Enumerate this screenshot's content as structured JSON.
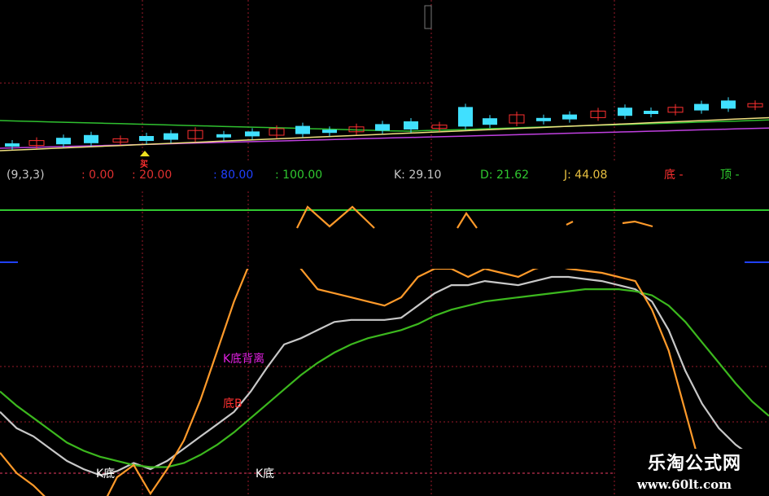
{
  "header": {
    "params": "(9,3,3)",
    "level_0": ": 0.00",
    "level_20": ": 20.00",
    "level_80": ": 80.00",
    "level_100": ": 100.00",
    "k_label": "K: 29.10",
    "d_label": "D: 21.62",
    "j_label": "J: 44.08",
    "bottom_label": "底 -",
    "top_label": "顶 -"
  },
  "colors": {
    "k_line": "#c8c8c8",
    "d_line": "#3cb81e",
    "j_line": "#ff9a2a",
    "grid": "#9a1a2a",
    "header_params": "#c8c8c8",
    "level_0": "#e03030",
    "level_20": "#e03030",
    "level_80": "#2040ff",
    "level_100": "#30c830",
    "k_text": "#c8c8c8",
    "d_text": "#30c830",
    "j_text": "#e8c040",
    "bottom_text": "#ff3030",
    "top_text": "#30d030",
    "magenta_label": "#e020e0",
    "red_label": "#ff3030"
  },
  "annotations": {
    "k_bottom_divergence": "K底背离",
    "bottom_b": "底B",
    "k_bottom_1": "K底",
    "k_bottom_2": "K底"
  },
  "price_panel": {
    "buy_marker": "买"
  },
  "watermark": {
    "title": "乐淘公式网",
    "url": "www.60lt.com"
  },
  "chart_data": [
    {
      "type": "candlestick",
      "title": "",
      "x": [
        0,
        1,
        2,
        3,
        4,
        5,
        6,
        7,
        8,
        9,
        10,
        11,
        12,
        13,
        14,
        15,
        16,
        17,
        18,
        19,
        20,
        21,
        22,
        23,
        24,
        25,
        26,
        27,
        28,
        29,
        30,
        31,
        32,
        33,
        34,
        35,
        36,
        37,
        38,
        39,
        40,
        41,
        42,
        43,
        44,
        45
      ],
      "candles_note": "",
      "series": [
        {
          "name": "",
          "values": [
            176,
            176,
            175,
            174,
            173,
            173,
            172,
            171,
            170,
            170,
            169,
            168,
            168,
            167,
            166,
            166,
            166,
            165,
            165,
            164,
            164,
            164,
            163,
            163,
            163,
            163,
            162,
            162,
            162,
            162,
            161,
            161,
            160,
            160,
            160,
            160,
            159,
            159,
            158,
            158,
            158,
            157,
            157,
            157,
            156,
            156
          ]
        }
      ]
    },
    {
      "type": "line",
      "title": "",
      "x": [
        0,
        1,
        2,
        3,
        4,
        5,
        6,
        7,
        8,
        9,
        10,
        11,
        12,
        13,
        14,
        15,
        16,
        17,
        18,
        19,
        20,
        21,
        22,
        23,
        24,
        25,
        26,
        27,
        28,
        29,
        30,
        31,
        32,
        33,
        34,
        35,
        36,
        37,
        38,
        39,
        40,
        41,
        42,
        43,
        44,
        45,
        46
      ],
      "ylim": [
        -5,
        105
      ],
      "levels": [
        0,
        20,
        80,
        100
      ],
      "series": [
        {
          "name": "K",
          "values": [
            30,
            22,
            18,
            12,
            6,
            2,
            -1,
            1,
            5,
            2,
            6,
            12,
            18,
            24,
            30,
            40,
            52,
            63,
            66,
            70,
            74,
            75,
            75,
            75,
            76,
            82,
            88,
            92,
            92,
            94,
            93,
            92,
            94,
            96,
            96,
            95,
            94,
            92,
            90,
            84,
            70,
            50,
            34,
            22,
            14,
            8,
            4
          ]
        },
        {
          "name": "D",
          "values": [
            40,
            33,
            27,
            21,
            15,
            11,
            8,
            6,
            4,
            3,
            3,
            5,
            9,
            14,
            20,
            27,
            34,
            41,
            48,
            54,
            59,
            63,
            66,
            68,
            70,
            73,
            77,
            80,
            82,
            84,
            85,
            86,
            87,
            88,
            89,
            90,
            90,
            90,
            89,
            87,
            82,
            74,
            64,
            54,
            44,
            35,
            28
          ]
        },
        {
          "name": "J",
          "values": [
            10,
            0,
            -6,
            -14,
            -20,
            -20,
            -18,
            -2,
            4,
            -10,
            2,
            16,
            36,
            60,
            84,
            104,
            112,
            110,
            100,
            90,
            88,
            86,
            84,
            82,
            86,
            96,
            100,
            100,
            96,
            100,
            98,
            96,
            100,
            102,
            100,
            99,
            98,
            96,
            94,
            80,
            60,
            30,
            0,
            -8,
            -12,
            -16,
            -18
          ]
        }
      ]
    }
  ]
}
